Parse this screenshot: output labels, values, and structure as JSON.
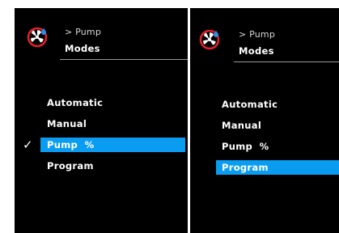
{
  "left_screen": {
    "breadcrumb": "> Pump",
    "title": "Modes",
    "items": [
      {
        "label": "Automatic"
      },
      {
        "label": "Manual"
      },
      {
        "label": "Pump  %"
      },
      {
        "label": "Program"
      }
    ],
    "selected_index": 2,
    "checked_index": 2
  },
  "right_screen": {
    "breadcrumb": "> Pump",
    "title": "Modes",
    "items": [
      {
        "label": "Automatic"
      },
      {
        "label": "Manual"
      },
      {
        "label": "Pump  %"
      },
      {
        "label": "Program"
      }
    ],
    "selected_index": 3
  },
  "icons": {
    "pump": "pump-fan-icon",
    "check": "checkmark-icon"
  },
  "colors": {
    "screen_bg": "#000000",
    "highlight": "#0a9cf0",
    "icon_red": "#e0202a",
    "icon_blue": "#2a8fe8",
    "text": "#ffffff"
  },
  "symbols": {
    "check": "✓"
  }
}
